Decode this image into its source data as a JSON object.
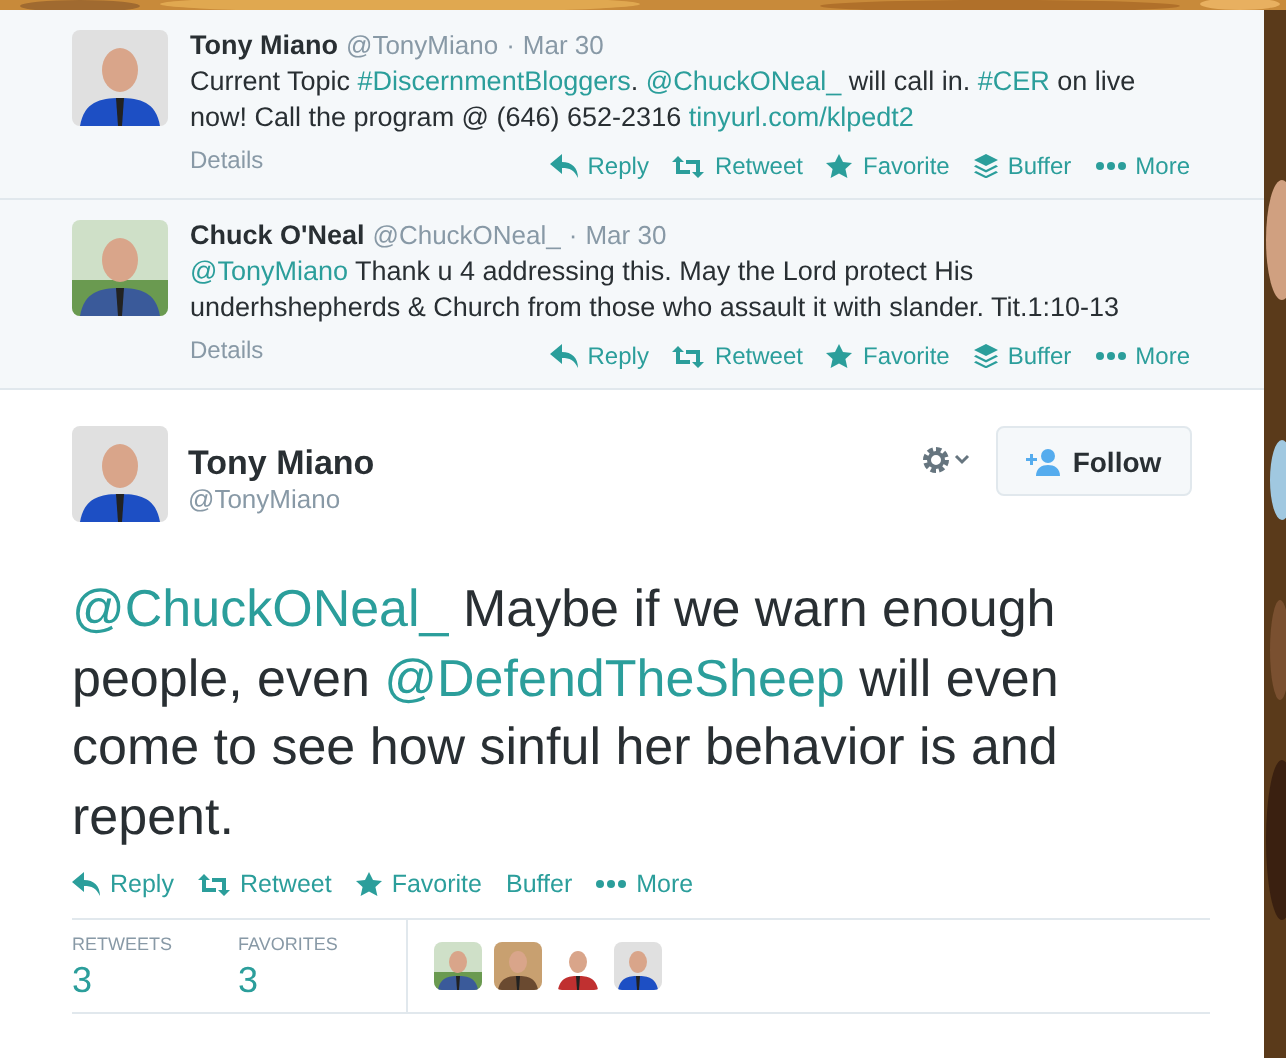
{
  "conversation": [
    {
      "name": "Tony Miano",
      "handle": "@TonyMiano",
      "separator": "·",
      "time": "Mar 30",
      "text": [
        {
          "kind": "plain",
          "text": "Current Topic "
        },
        {
          "kind": "link",
          "text": "#DiscernmentBloggers"
        },
        {
          "kind": "plain",
          "text": ".  "
        },
        {
          "kind": "link",
          "text": "@ChuckONeal_"
        },
        {
          "kind": "plain",
          "text": " will call in.  "
        },
        {
          "kind": "link",
          "text": "#CER"
        },
        {
          "kind": "plain",
          "text": " on live now! Call the program @ (646) 652-2316 "
        },
        {
          "kind": "link",
          "text": "tinyurl.com/klpedt2"
        }
      ],
      "details": "Details",
      "actions": [
        {
          "kind": "reply",
          "label": "Reply"
        },
        {
          "kind": "retweet",
          "label": "Retweet"
        },
        {
          "kind": "favorite",
          "label": "Favorite"
        },
        {
          "kind": "buffer",
          "label": "Buffer"
        },
        {
          "kind": "more",
          "label": "More"
        }
      ]
    },
    {
      "name": "Chuck O'Neal",
      "handle": "@ChuckONeal_",
      "separator": "·",
      "time": "Mar 30",
      "text": [
        {
          "kind": "link",
          "text": "@TonyMiano"
        },
        {
          "kind": "plain",
          "text": " Thank u 4 addressing this. May the Lord protect His underhshepherds & Church from those who assault it with slander. Tit.1:10-13"
        }
      ],
      "details": "Details",
      "actions": [
        {
          "kind": "reply",
          "label": "Reply"
        },
        {
          "kind": "retweet",
          "label": "Retweet"
        },
        {
          "kind": "favorite",
          "label": "Favorite"
        },
        {
          "kind": "buffer",
          "label": "Buffer"
        },
        {
          "kind": "more",
          "label": "More"
        }
      ]
    }
  ],
  "tweet": {
    "name": "Tony Miano",
    "handle": "@TonyMiano",
    "follow": "Follow",
    "text": [
      {
        "kind": "link",
        "text": "@ChuckONeal_"
      },
      {
        "kind": "plain",
        "text": " Maybe if we warn enough people, even "
      },
      {
        "kind": "link",
        "text": "@DefendTheSheep"
      },
      {
        "kind": "plain",
        "text": " will even come to see how sinful her behavior is and repent."
      }
    ],
    "actions": [
      {
        "kind": "reply",
        "label": "Reply"
      },
      {
        "kind": "retweet",
        "label": "Retweet"
      },
      {
        "kind": "favorite",
        "label": "Favorite"
      },
      {
        "kind": "text",
        "label": "Buffer"
      },
      {
        "kind": "more",
        "label": "More"
      }
    ],
    "stats": [
      {
        "label": "RETWEETS",
        "count": "3"
      },
      {
        "label": "FAVORITES",
        "count": "3"
      }
    ]
  }
}
